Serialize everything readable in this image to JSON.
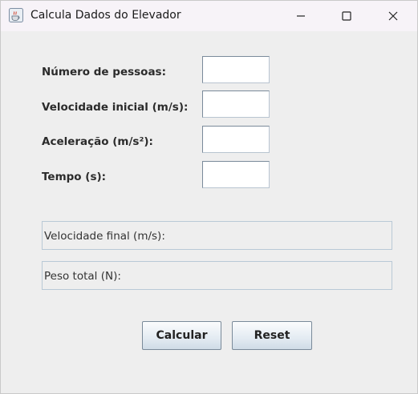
{
  "window": {
    "title": "Calcula Dados do Elevador",
    "icon": "java-cup-icon",
    "controls": {
      "minimize_icon": "minimize-icon",
      "maximize_icon": "maximize-icon",
      "close_icon": "close-icon"
    }
  },
  "form": {
    "fields": [
      {
        "label": "Número de pessoas:",
        "value": ""
      },
      {
        "label": "Velocidade inicial (m/s):",
        "value": ""
      },
      {
        "label": "Aceleração (m/s²):",
        "value": ""
      },
      {
        "label": "Tempo (s):",
        "value": ""
      }
    ]
  },
  "results": {
    "final_velocity_label": "Velocidade final (m/s):",
    "total_weight_label": "Peso total (N):"
  },
  "buttons": {
    "calculate_label": "Calcular",
    "reset_label": "Reset"
  },
  "colors": {
    "background": "#eeeeee",
    "titlebar": "#f7f3f8",
    "result_border": "#b9c9d6",
    "button_gradient_top": "#fbfcfd",
    "button_gradient_bottom": "#cfdbe6"
  }
}
